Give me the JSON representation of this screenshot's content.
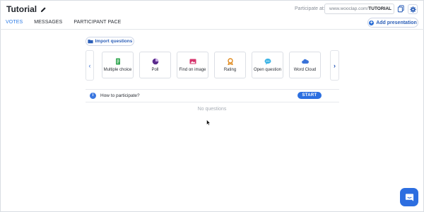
{
  "header": {
    "title": "Tutorial",
    "participate_label": "Participate at:",
    "url_prefix": "www.wooclap.com/",
    "url_code": "TUTORIAL"
  },
  "tabs": [
    {
      "label": "VOTES",
      "active": true
    },
    {
      "label": "MESSAGES",
      "active": false
    },
    {
      "label": "PARTICIPANT PACE",
      "active": false
    }
  ],
  "add_presentation_label": "Add presentation",
  "import_questions_label": "Import questions",
  "question_types": [
    {
      "label": "Multiple choice",
      "icon": "mcq-icon",
      "color": "#34a853"
    },
    {
      "label": "Poll",
      "icon": "poll-icon",
      "color": "#5b2b8c"
    },
    {
      "label": "Find on image",
      "icon": "image-icon",
      "color": "#d6336c"
    },
    {
      "label": "Rating",
      "icon": "rating-icon",
      "color": "#e08a1e"
    },
    {
      "label": "Open question",
      "icon": "speech-bubble-icon",
      "color": "#3fb5e6"
    },
    {
      "label": "Word Cloud",
      "icon": "cloud-icon",
      "color": "#3a73d8"
    }
  ],
  "how_to_participate": {
    "label": "How to participate?",
    "start_label": "START"
  },
  "empty_state": "No questions",
  "colors": {
    "accent": "#2c7be5",
    "start_button": "#2c6fe0",
    "chat_button": "#2d6ee0"
  }
}
